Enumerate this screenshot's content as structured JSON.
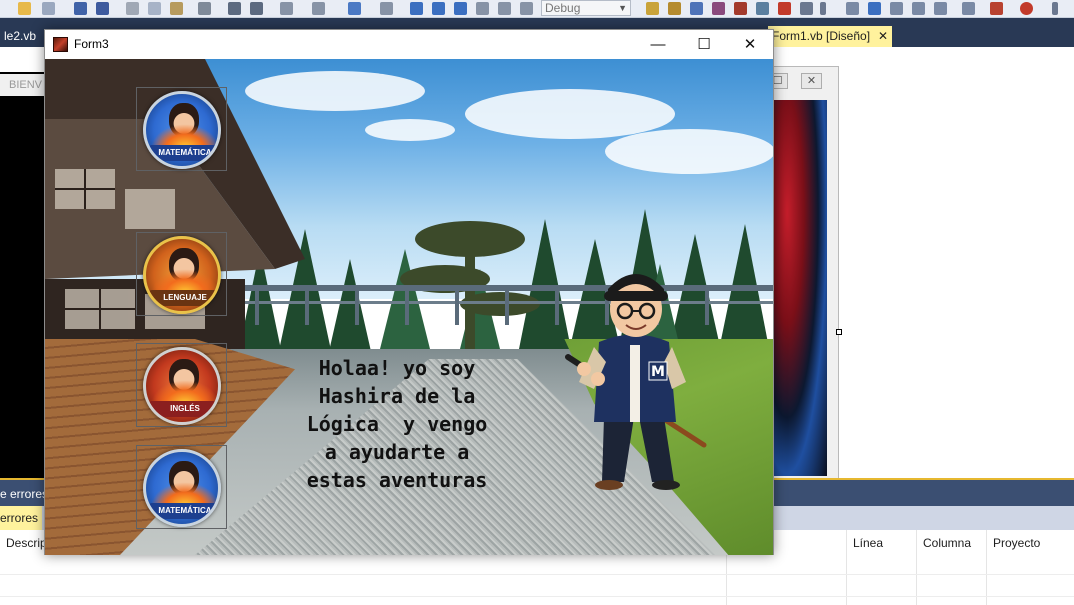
{
  "ide": {
    "toolbar": {
      "config_combo": "Debug"
    },
    "tabs": [
      {
        "label": "le2.vb",
        "active": false
      },
      {
        "label": "Form1.vb [Diseño]",
        "active": true
      }
    ],
    "left_form_title": "BIENV"
  },
  "error_list": {
    "panel_label": "e errores",
    "tab_label": "errores",
    "columns": [
      "Descrip",
      "Línea",
      "Columna",
      "Proyecto"
    ]
  },
  "form": {
    "title": "Form3",
    "buttons": {
      "minimize": "—",
      "maximize": "☐",
      "close": "✕"
    },
    "menu": [
      {
        "label": "MATEMÁTICA",
        "ring": "#2e6ad1",
        "ribbon": "#1d3f8f"
      },
      {
        "label": "LENGUAJE",
        "ring": "#e0b12c",
        "ribbon": "#7a3a12"
      },
      {
        "label": "INGLÉS",
        "ring": "#c9c9c9",
        "ribbon": "#8b1f1f"
      },
      {
        "label": "MATEMÁTICA",
        "ring": "#2e6ad1",
        "ribbon": "#1d3f8f"
      }
    ],
    "intro_lines": [
      "Holaa! yo soy",
      "Hashira de la",
      "Lógica  y vengo",
      "a ayudarte a",
      "estas aventuras"
    ],
    "character_initial": "M"
  }
}
